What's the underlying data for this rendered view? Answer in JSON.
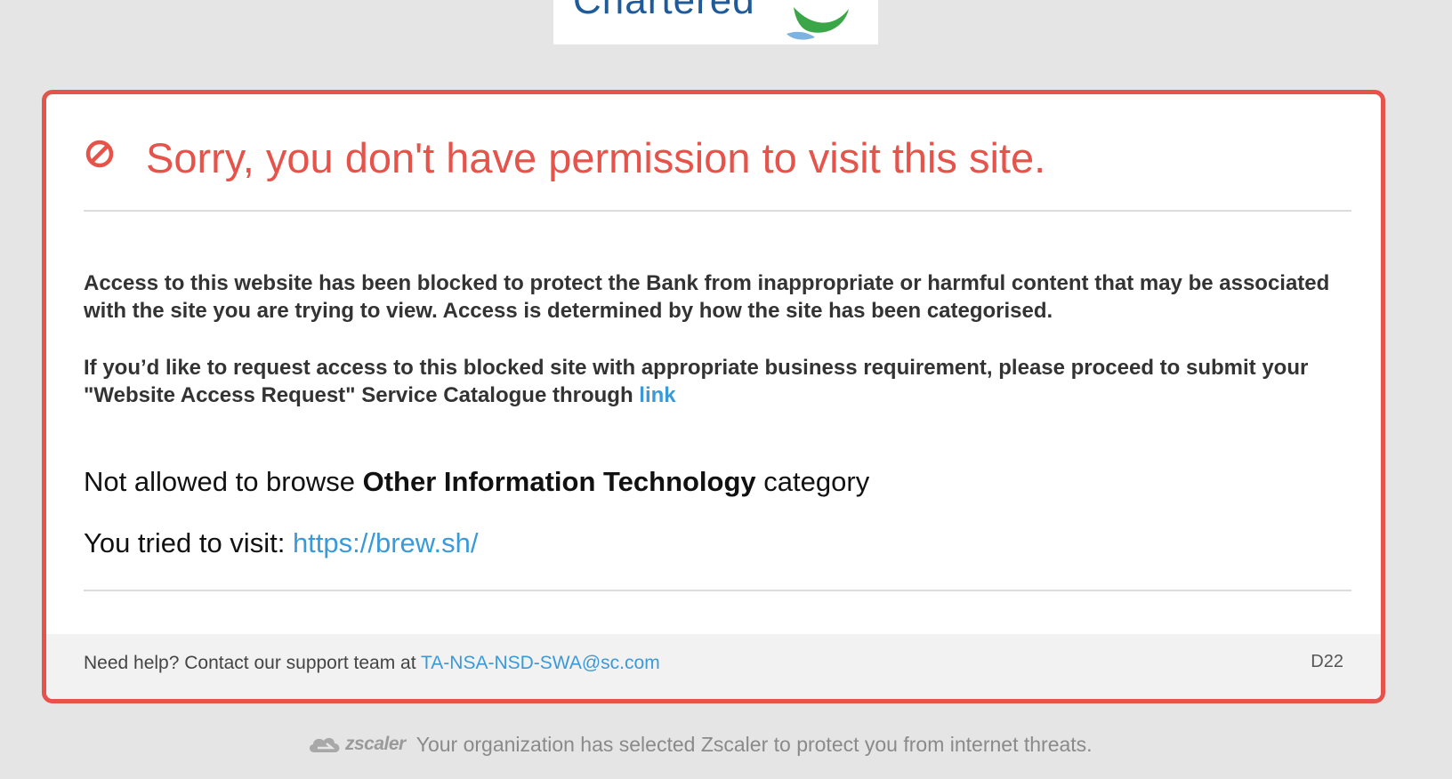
{
  "logo": {
    "text": "Chartered"
  },
  "alert": {
    "icon": "no-entry-icon",
    "title": "Sorry, you don't have permission to visit this site.",
    "paragraph1": "Access to this website has been blocked to protect the Bank from inappropriate or harmful content that may be associated with the site you are trying to view. Access is determined by how the site has been categorised.",
    "paragraph2": "If you’d like to request access to this blocked site with appropriate business requirement, please proceed to submit your \"Website Access Request\" Service Catalogue through",
    "request_link": "link",
    "category_prefix": "Not allowed to browse",
    "category_name": "Other Information Technology",
    "category_suffix": "category",
    "visit_label": "You tried to visit:",
    "visit_url": "https://brew.sh/"
  },
  "footer": {
    "help_text": "Need help? Contact our support team at",
    "support_email": "TA-NSA-NSD-SWA@sc.com",
    "code": "D22"
  },
  "branding": {
    "logo_icon": "zscaler-cloud-icon",
    "logo_text": "zscaler",
    "message": "Your organization has selected Zscaler to protect you from internet threats."
  },
  "colors": {
    "accent_red": "#e5534b",
    "link_blue": "#3a9ad9",
    "page_background": "#e5e5e5"
  }
}
